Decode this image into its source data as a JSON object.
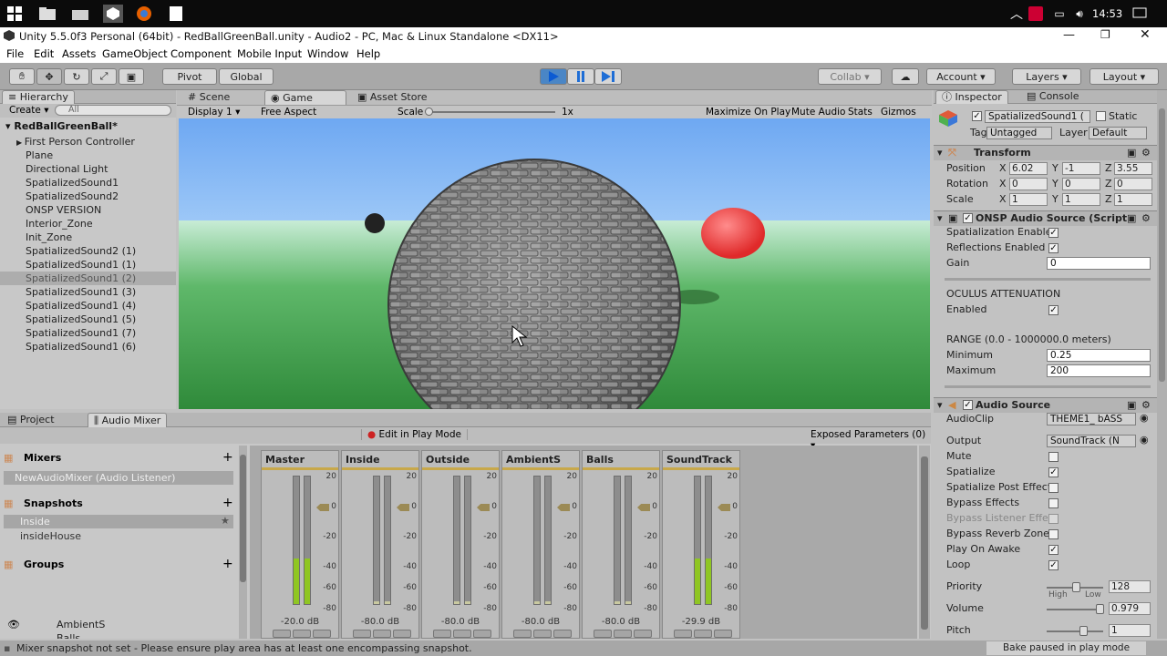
{
  "taskbar": {
    "time": "14:53"
  },
  "window": {
    "title": "Unity 5.5.0f3 Personal (64bit) - RedBallGreenBall.unity - Audio2 - PC, Mac & Linux Standalone <DX11>"
  },
  "menu": [
    "File",
    "Edit",
    "Assets",
    "GameObject",
    "Component",
    "Mobile Input",
    "Window",
    "Help"
  ],
  "toolbar": {
    "pivot": "Pivot",
    "global": "Global",
    "collab": "Collab",
    "account": "Account",
    "layers": "Layers",
    "layout": "Layout"
  },
  "hierarchy": {
    "tab": "Hierarchy",
    "create": "Create",
    "search_placeholder": "All",
    "scene": "RedBallGreenBall*",
    "items": [
      "First Person Controller",
      "Plane",
      "Directional Light",
      "SpatializedSound1",
      "SpatializedSound2",
      "ONSP VERSION",
      "Interior_Zone",
      "Init_Zone",
      "SpatializedSound2 (1)",
      "SpatializedSound1 (1)",
      "SpatializedSound1 (2)",
      "SpatializedSound1 (3)",
      "SpatializedSound1 (4)",
      "SpatializedSound1 (5)",
      "SpatializedSound1 (7)",
      "SpatializedSound1 (6)"
    ],
    "selected_index": 10
  },
  "game": {
    "tabs": [
      "Scene",
      "Game",
      "Asset Store"
    ],
    "display": "Display 1",
    "aspect": "Free Aspect",
    "scale_label": "Scale",
    "scale_value": "1x",
    "options": [
      "Maximize On Play",
      "Mute Audio",
      "Stats",
      "Gizmos"
    ]
  },
  "inspector": {
    "tabs": [
      "Inspector",
      "Console"
    ],
    "object_name": "SpatializedSound1 (",
    "static": "Static",
    "tag_label": "Tag",
    "tag": "Untagged",
    "layer_label": "Layer",
    "layer": "Default",
    "transform": {
      "title": "Transform",
      "position": {
        "label": "Position",
        "x": "6.02",
        "y": "-1",
        "z": "3.55"
      },
      "rotation": {
        "label": "Rotation",
        "x": "0",
        "y": "0",
        "z": "0"
      },
      "scale": {
        "label": "Scale",
        "x": "1",
        "y": "1",
        "z": "1"
      }
    },
    "onsp": {
      "title": "ONSP Audio Source (Script",
      "spatialization": "Spatialization Enable",
      "reflections": "Reflections Enabled",
      "gain_label": "Gain",
      "gain": "0",
      "attenuation_header": "OCULUS ATTENUATION",
      "enabled": "Enabled",
      "range_header": "RANGE (0.0 - 1000000.0 meters)",
      "min_label": "Minimum",
      "min": "0.25",
      "max_label": "Maximum",
      "max": "200"
    },
    "audio_source": {
      "title": "Audio Source",
      "clip_label": "AudioClip",
      "clip": "THEME1_ bASS",
      "output_label": "Output",
      "output": "SoundTrack (N",
      "mute": "Mute",
      "spatialize": "Spatialize",
      "spatialize_post": "Spatialize Post Effect",
      "bypass_effects": "Bypass Effects",
      "bypass_listener": "Bypass Listener Effe",
      "bypass_reverb": "Bypass Reverb Zone",
      "play_on_awake": "Play On Awake",
      "loop": "Loop",
      "priority_label": "Priority",
      "priority": "128",
      "high": "High",
      "low": "Low",
      "volume_label": "Volume",
      "volume": "0.979",
      "pitch_label": "Pitch",
      "pitch": "1"
    }
  },
  "mixer": {
    "tabs": [
      "Project",
      "Audio Mixer"
    ],
    "edit_play": "Edit in Play Mode",
    "exposed": "Exposed Parameters (0)",
    "mixers_title": "Mixers",
    "mixer_item": "NewAudioMixer  (Audio Listener)",
    "snapshots_title": "Snapshots",
    "snapshots": [
      "Inside",
      "insideHouse"
    ],
    "groups_title": "Groups",
    "groups": [
      "AmbientS",
      "Balls"
    ],
    "scale": [
      "20",
      "0",
      "-20",
      "-40",
      "-60",
      "-80"
    ],
    "strips": [
      {
        "name": "Master",
        "db": "-20.0 dB",
        "level": 0.36
      },
      {
        "name": "Inside",
        "db": "-80.0 dB",
        "level": 0.02
      },
      {
        "name": "Outside",
        "db": "-80.0 dB",
        "level": 0.02
      },
      {
        "name": "AmbientS",
        "db": "-80.0 dB",
        "level": 0.02
      },
      {
        "name": "Balls",
        "db": "-80.0 dB",
        "level": 0.02
      },
      {
        "name": "SoundTrack",
        "db": "-29.9 dB",
        "level": 0.36
      }
    ]
  },
  "status": {
    "message": "Mixer snapshot not set - Please ensure play area has at least one encompassing snapshot.",
    "bake": "Bake paused in play mode"
  }
}
